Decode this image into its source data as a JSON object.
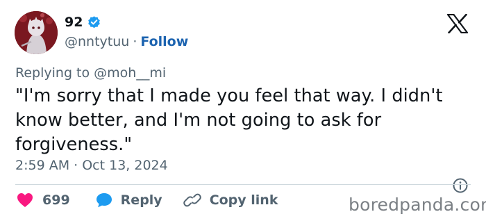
{
  "author": {
    "display_name": "92",
    "handle": "@nntytuu",
    "separator": "·",
    "follow_label": "Follow"
  },
  "tweet": {
    "replying_to": "Replying to @moh__mi",
    "text": "\"I'm sorry that I made you feel that way. I didn't\nknow better, and I'm not going to ask for\nforgiveness.\"",
    "timestamp": "2:59 AM · Oct 13, 2024"
  },
  "actions": {
    "like_count": "699",
    "reply_label": "Reply",
    "copy_label": "Copy link"
  },
  "watermark": "boredpanda.com",
  "icons": [
    "avatar-image",
    "verified-badge-icon",
    "x-logo-icon",
    "info-icon",
    "heart-icon",
    "reply-bubble-icon",
    "link-icon"
  ],
  "colors": {
    "text": "#0f1419",
    "secondary": "#536471",
    "follow": "#1d64b0",
    "verified": "#1d9bf0",
    "heart": "#f91880",
    "reply_bubble": "#1d9bf0",
    "divider": "#cfd9de",
    "avatar_bg": "#7a1820"
  }
}
